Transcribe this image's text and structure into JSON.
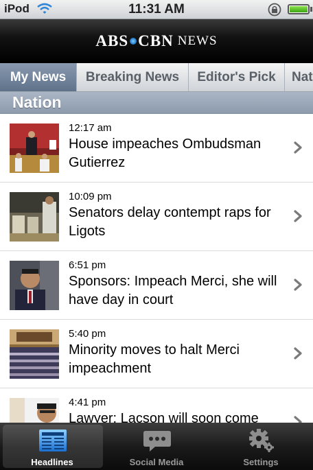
{
  "status_bar": {
    "carrier": "iPod",
    "time": "11:31 AM"
  },
  "header": {
    "logo_abs": "ABS",
    "logo_cbn": "CBN",
    "logo_news": "NEWS"
  },
  "tabs": [
    {
      "label": "My News",
      "active": true
    },
    {
      "label": "Breaking News",
      "active": false
    },
    {
      "label": "Editor's Pick",
      "active": false
    },
    {
      "label": "Nat",
      "active": false
    }
  ],
  "section": {
    "title": "Nation"
  },
  "news": [
    {
      "time": "12:17 am",
      "title": "House impeaches Ombudsman Gutierrez"
    },
    {
      "time": "10:09 pm",
      "title": "Senators delay contempt raps for Ligots"
    },
    {
      "time": "6:51 pm",
      "title": "Sponsors: Impeach Merci, she will have day in court"
    },
    {
      "time": "5:40 pm",
      "title": "Minority moves to halt Merci impeachment"
    },
    {
      "time": "4:41 pm",
      "title": "Lawyer: Lacson will soon come"
    }
  ],
  "bottom_tabs": [
    {
      "label": "Headlines",
      "icon": "newspaper-icon",
      "active": true
    },
    {
      "label": "Social Media",
      "icon": "speech-bubble-icon",
      "active": false
    },
    {
      "label": "Settings",
      "icon": "gear-icon",
      "active": false
    }
  ],
  "colors": {
    "active_tab": "#6f8198",
    "section_bar": "#9aa7b8",
    "header_bg": "#000000"
  }
}
